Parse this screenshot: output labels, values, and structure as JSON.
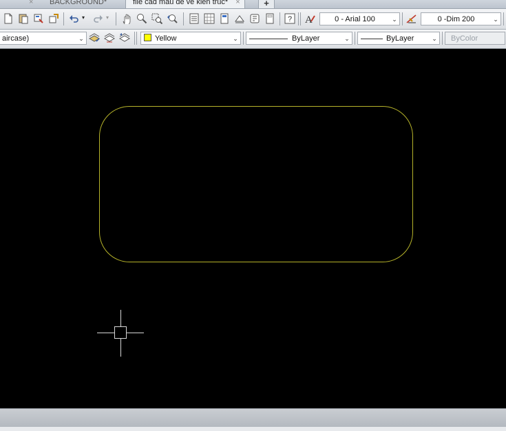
{
  "tabs": {
    "background_tab": "BACKGROUND*",
    "active_tab": "file cad mau de ve kien truc*",
    "close_glyph": "×",
    "add_glyph": "+"
  },
  "toolbar_top": {
    "icons": [
      "new-icon",
      "paste-icon",
      "match-properties-icon",
      "block-editor-icon",
      "undo-icon",
      "redo-icon",
      "pan-icon",
      "zoom-realtime-icon",
      "zoom-window-icon",
      "zoom-previous-icon",
      "properties-icon",
      "design-center-icon",
      "tool-palettes-icon",
      "sheet-set-icon",
      "markup-icon",
      "quickcalc-icon",
      "help-icon",
      "text-style-icon",
      "dim-style-icon"
    ],
    "text_style": "0 - Arial 100",
    "dim_style": "0 -Dim 200"
  },
  "toolbar_layers": {
    "layer_name": "aircase)",
    "color_value": "Yellow",
    "linetype_value": "ByLayer",
    "lineweight_value": "ByLayer",
    "plotstyle_value": "ByColor"
  },
  "colors": {
    "canvas": "#000000",
    "shape_stroke": "#b7b42a",
    "layer_color": "#ffff00"
  }
}
